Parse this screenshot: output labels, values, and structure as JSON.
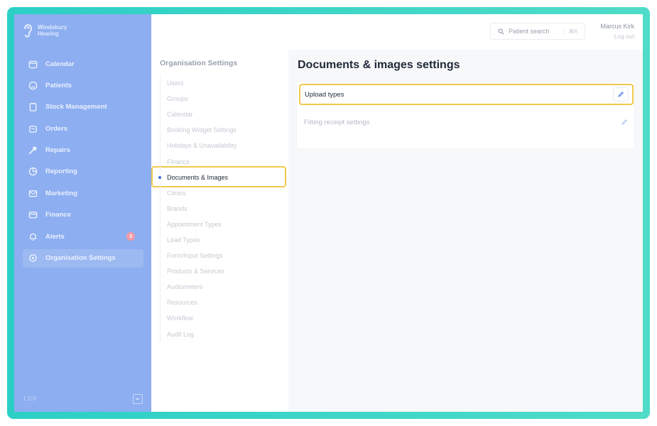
{
  "brand": {
    "line1": "Windsbury",
    "line2": "Hearing"
  },
  "sidebar": {
    "items": [
      {
        "label": "Calendar",
        "icon": "calendar-icon"
      },
      {
        "label": "Patients",
        "icon": "smile-icon"
      },
      {
        "label": "Stock Management",
        "icon": "clipboard-icon"
      },
      {
        "label": "Orders",
        "icon": "cart-icon"
      },
      {
        "label": "Repairs",
        "icon": "wrench-icon"
      },
      {
        "label": "Reporting",
        "icon": "pie-chart-icon"
      },
      {
        "label": "Marketing",
        "icon": "mail-icon"
      },
      {
        "label": "Finance",
        "icon": "credit-card-icon"
      },
      {
        "label": "Alerts",
        "icon": "bell-icon",
        "badge": "3"
      },
      {
        "label": "Organisation Settings",
        "icon": "gear-icon"
      }
    ],
    "version": "1.0.0"
  },
  "topbar": {
    "search_label": "Patient search",
    "search_shortcut": "⌘K",
    "user_name": "Marcus Kirk",
    "logout_label": "Log out"
  },
  "settings_nav": {
    "title": "Organisation Settings",
    "items": [
      "Users",
      "Groups",
      "Calendar",
      "Booking Widget Settings",
      "Holidays & Unavailability",
      "Finance",
      "Documents & Images",
      "Clinics",
      "Brands",
      "Appointment Types",
      "Lead Types",
      "Form/Input Settings",
      "Products & Services",
      "Audiometers",
      "Resources",
      "Workflow",
      "Audit Log"
    ],
    "active": "Documents & Images"
  },
  "main": {
    "title": "Documents & images settings",
    "rows": [
      "Upload types",
      "Fitting receipt settings"
    ]
  },
  "colors": {
    "frame": "#2ccfc6",
    "sidebar": "#8daef0",
    "highlight": "#f2c94c",
    "accent": "#3b6fe0"
  }
}
